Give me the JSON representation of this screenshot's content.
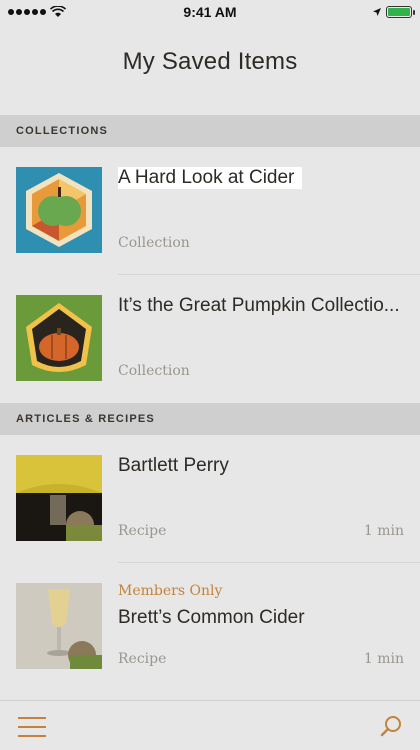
{
  "status_bar": {
    "time": "9:41 AM"
  },
  "page": {
    "title": "My Saved Items"
  },
  "sections": {
    "collections_label": "COLLECTIONS",
    "articles_label": "ARTICLES & RECIPES"
  },
  "collections": [
    {
      "title": "A Hard Look at Cider",
      "type": "Collection"
    },
    {
      "title": "It’s the Great Pumpkin Collectio...",
      "type": "Collection"
    }
  ],
  "articles": [
    {
      "badge": "",
      "title": "Bartlett Perry",
      "type": "Recipe",
      "duration": "1 min"
    },
    {
      "badge": "Members Only",
      "title": "Brett’s Common Cider",
      "type": "Recipe",
      "duration": "1 min"
    }
  ],
  "colors": {
    "accent": "#c4823a",
    "background": "#e7e7e7",
    "section_header": "#cfcfcf"
  },
  "icons": {
    "menu": "menu-icon",
    "search": "search-icon"
  }
}
